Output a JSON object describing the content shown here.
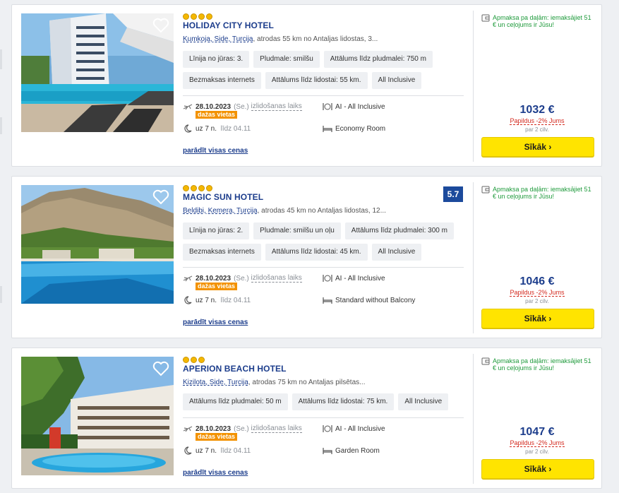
{
  "hotels": [
    {
      "stars": 4,
      "name": "HOLIDAY CITY HOTEL",
      "location_link": "Kumkoja, Side, Turcija",
      "location_rest": ", atrodas 55 km no Antaljas lidostas, 3...",
      "tags": [
        "Līnija no jūras: 3.",
        "Pludmale: smilšu",
        "Attālums līdz pludmalei: 750 m",
        "Bezmaksas internets",
        "Attālums līdz lidostai: 55 km.",
        "All Inclusive"
      ],
      "rating": "",
      "date": "28.10.2023",
      "weekday": "(Se.)",
      "departure_label": "izlidošanas laiks",
      "few_seats": "dažas vietas",
      "board": "AI - All Inclusive",
      "nights": "uz 7 n.",
      "until": "līdz 04.11",
      "room": "Economy Room",
      "all_prices": "parādīt visas cenas",
      "pay_note": "Apmaksa pa daļām: iemaksājiet 51 € un ceļojums ir Jūsu!",
      "price": "1032 €",
      "discount": "Papildus -2% Jums",
      "per_people": "par 2 cilv.",
      "button": "Sīkāk ›"
    },
    {
      "stars": 4,
      "name": "MAGIC SUN HOTEL",
      "location_link": "Beldibi, Kemera, Turcija",
      "location_rest": ", atrodas 45 km no Antaljas lidostas, 12...",
      "tags": [
        "Līnija no jūras: 2.",
        "Pludmale: smilšu un oļu",
        "Attālums līdz pludmalei: 300 m",
        "Bezmaksas internets",
        "Attālums līdz lidostai: 45 km.",
        "All Inclusive"
      ],
      "rating": "5.7",
      "date": "28.10.2023",
      "weekday": "(Se.)",
      "departure_label": "izlidošanas laiks",
      "few_seats": "dažas vietas",
      "board": "AI - All Inclusive",
      "nights": "uz 7 n.",
      "until": "līdz 04.11",
      "room": "Standard without Balcony",
      "all_prices": "parādīt visas cenas",
      "pay_note": "Apmaksa pa daļām: iemaksājiet 51 € un ceļojums ir Jūsu!",
      "price": "1046 €",
      "discount": "Papildus -2% Jums",
      "per_people": "par 2 cilv.",
      "button": "Sīkāk ›"
    },
    {
      "stars": 3,
      "name": "APERION BEACH HOTEL",
      "location_link": "Kizilota, Side, Turcija",
      "location_rest": ", atrodas 75 km no Antaljas pilsētas...",
      "tags": [
        "Attālums līdz pludmalei: 50 m",
        "Attālums līdz lidostai: 75 km.",
        "All Inclusive"
      ],
      "rating": "",
      "date": "28.10.2023",
      "weekday": "(Se.)",
      "departure_label": "izlidošanas laiks",
      "few_seats": "dažas vietas",
      "board": "AI - All Inclusive",
      "nights": "uz 7 n.",
      "until": "līdz 04.11",
      "room": "Garden Room",
      "all_prices": "parādīt visas cenas",
      "pay_note": "Apmaksa pa daļām: iemaksājiet 51 € un ceļojums ir Jūsu!",
      "price": "1047 €",
      "discount": "Papildus -2% Jums",
      "per_people": "par 2 cilv.",
      "button": "Sīkāk ›"
    }
  ],
  "icons": {
    "favorite": "heart-icon",
    "flight": "plane-icon",
    "board": "cutlery-icon",
    "night": "moon-icon",
    "room": "bed-icon",
    "payment": "wallet-icon"
  },
  "colors": {
    "brand_blue": "#1c3d8c",
    "button_yellow": "#ffe400",
    "discount_red": "#d42a1f",
    "installment_green": "#1e9a3b",
    "few_seats_orange": "#f39200"
  }
}
